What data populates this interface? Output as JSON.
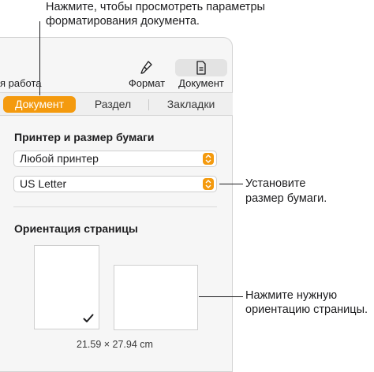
{
  "callouts": {
    "top_line1": "Нажмите, чтобы просмотреть параметры",
    "top_line2": "форматирования документа.",
    "right1_line1": "Установите",
    "right1_line2": "размер бумаги.",
    "right2_line1": "Нажмите нужную",
    "right2_line2": "ориентацию страницы."
  },
  "toolbar": {
    "left_partial": "я работа",
    "format_label": "Формат",
    "document_label": "Документ"
  },
  "tabs": [
    {
      "label": "Документ",
      "active": true
    },
    {
      "label": "Раздел",
      "active": false
    },
    {
      "label": "Закладки",
      "active": false
    }
  ],
  "printer_section": {
    "title": "Принтер и размер бумаги",
    "printer_value": "Любой принтер",
    "paper_value": "US Letter"
  },
  "orientation_section": {
    "title": "Ориентация страницы",
    "selected": "portrait",
    "size_text": "21.59 × 27.94 cm"
  },
  "colors": {
    "accent": "#f49a0e",
    "panel_bg": "#f6f6f6"
  },
  "icons": {
    "format": "paintbrush-icon",
    "document": "document-icon",
    "popup": "chevron-updown-icon",
    "check": "checkmark-icon"
  }
}
